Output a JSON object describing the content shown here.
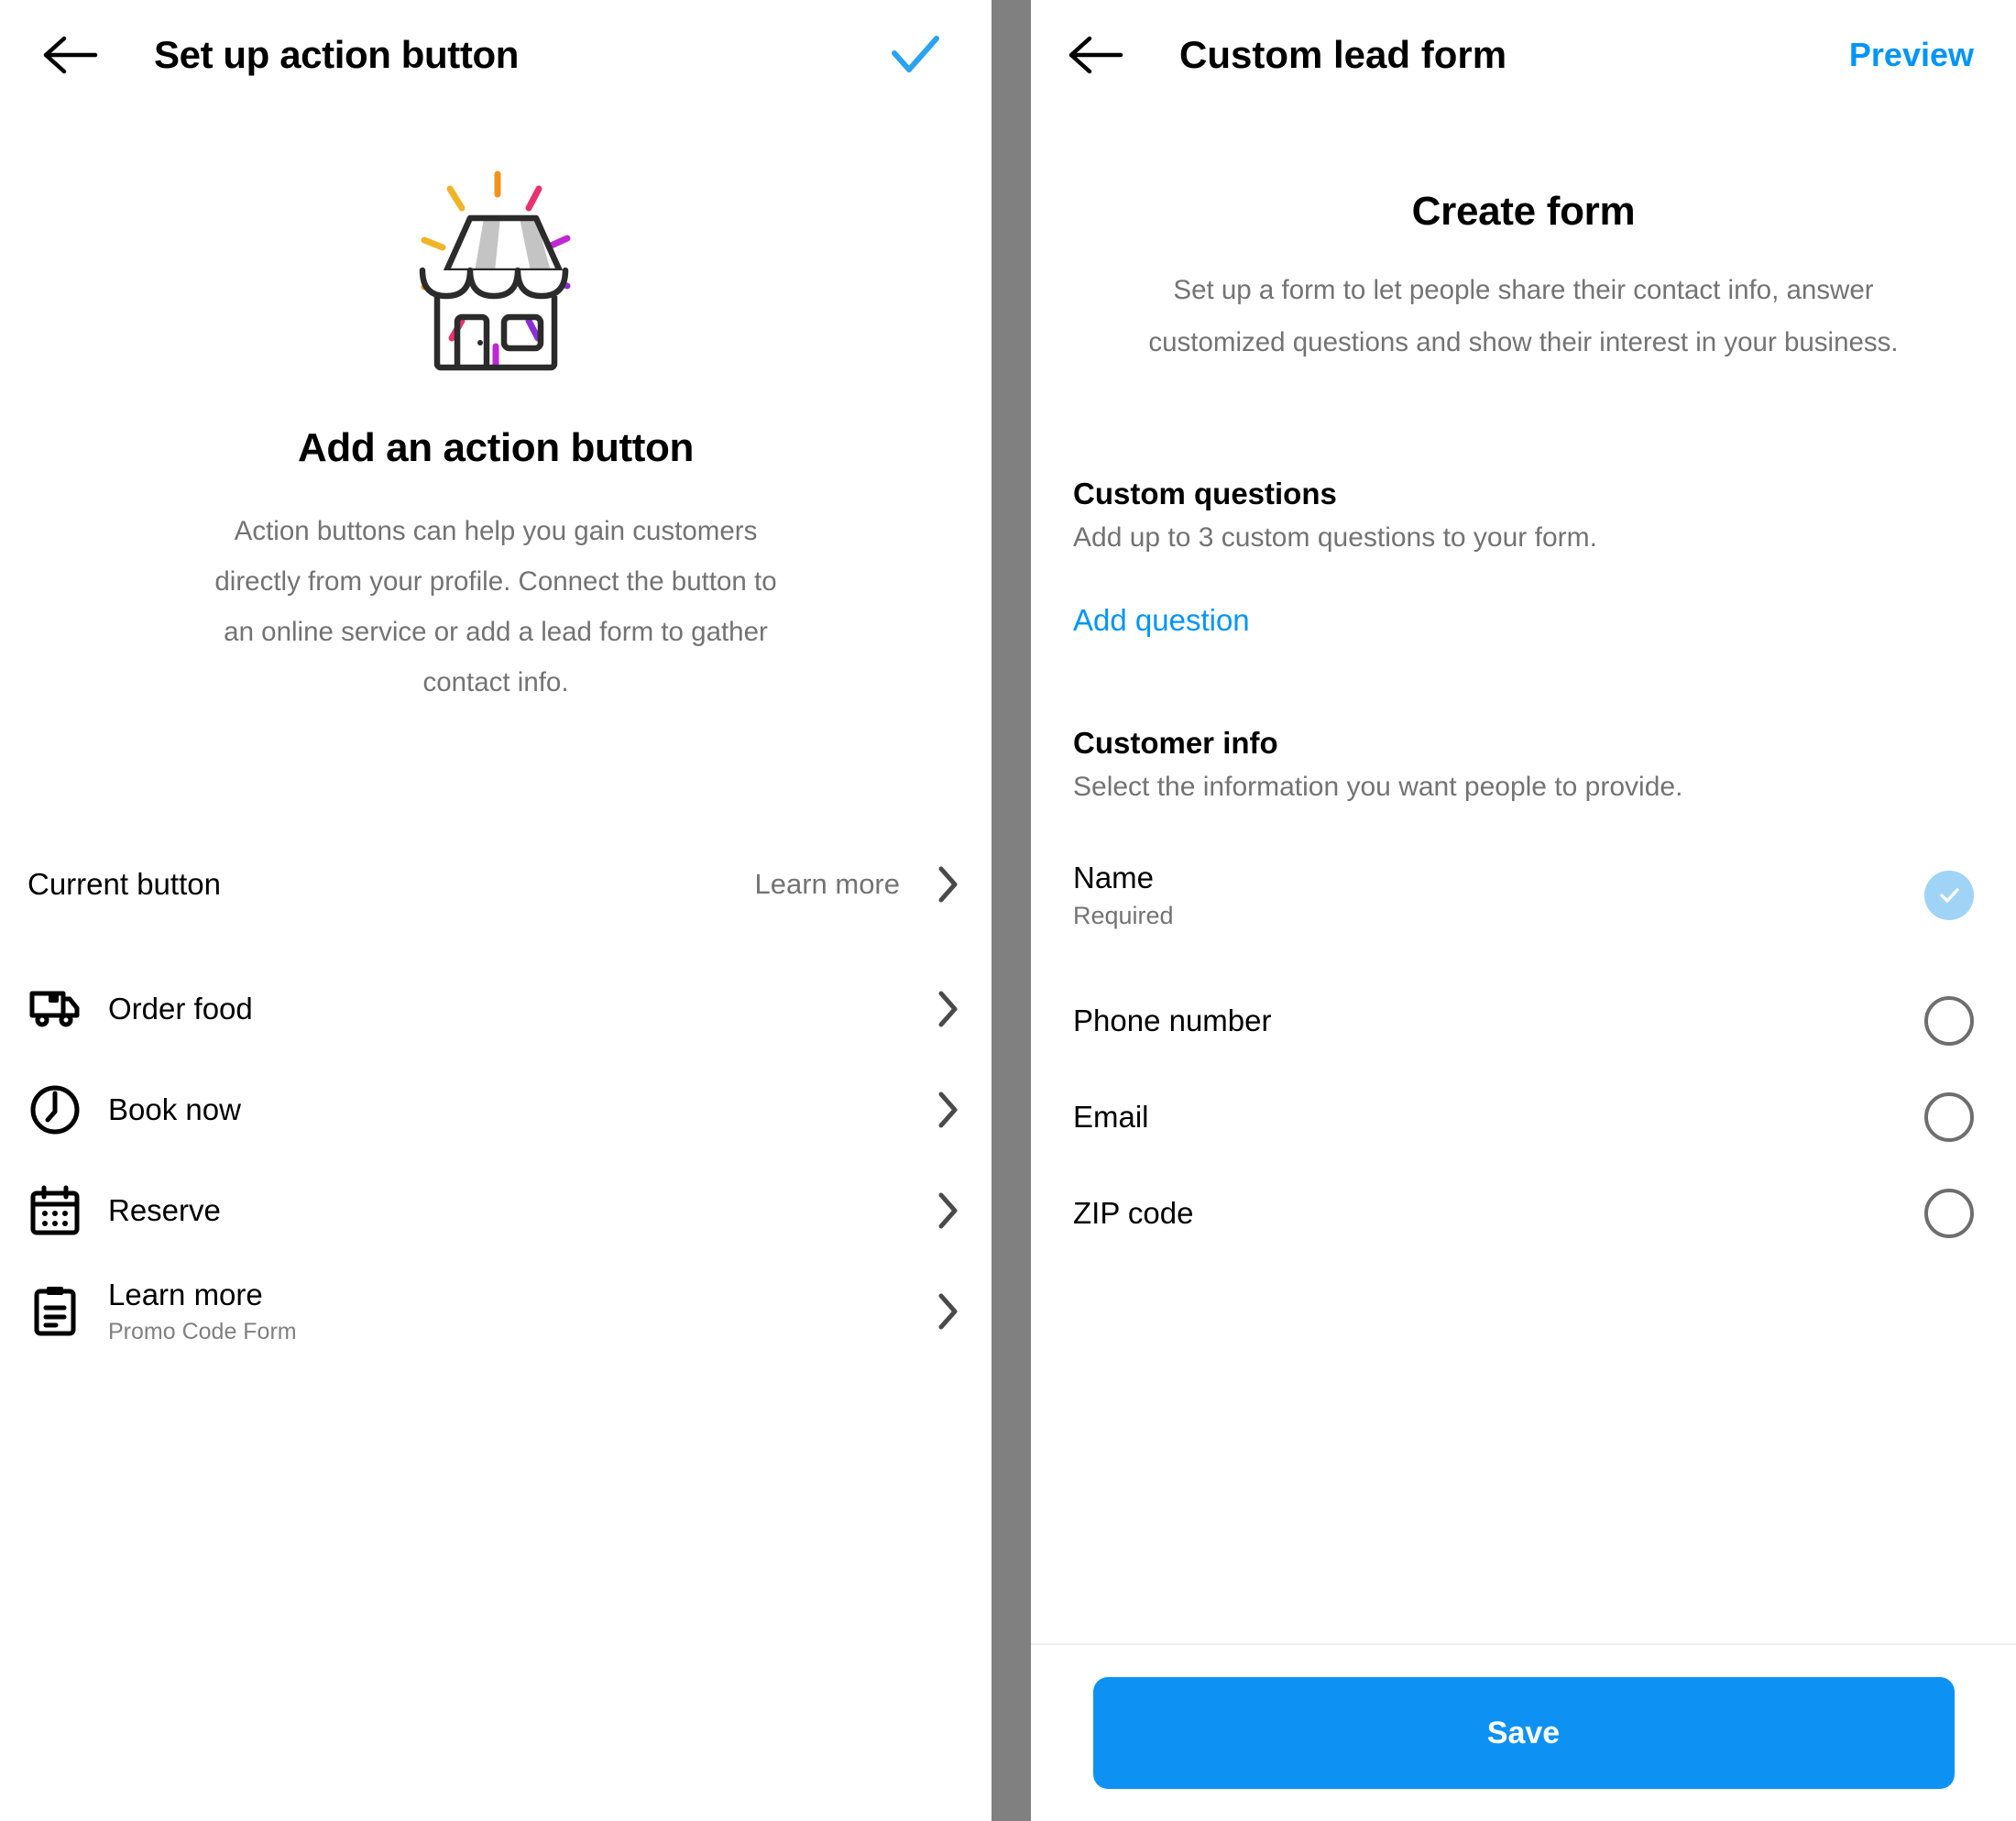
{
  "left_panel": {
    "header": {
      "back_icon": "back-arrow-icon",
      "title": "Set up action button",
      "confirm_icon": "checkmark-icon"
    },
    "illustration": {
      "name": "storefront-illustration",
      "sparkle_colors": [
        "#f2921d",
        "#f0b429",
        "#e8336e",
        "#c026d3",
        "#8b2fd6"
      ],
      "awning_stripe_color": "#c4c4c4",
      "outline_color": "#2b2b2b"
    },
    "title": "Add an action button",
    "description": "Action buttons can help you gain customers directly from your profile. Connect the button to an online service or add a lead form to gather contact info.",
    "current_button": {
      "label": "Current button",
      "value": "Learn more",
      "chevron_icon": "chevron-right-icon"
    },
    "actions": [
      {
        "icon": "delivery-truck-icon",
        "label": "Order food",
        "sublabel": ""
      },
      {
        "icon": "clock-icon",
        "label": "Book now",
        "sublabel": ""
      },
      {
        "icon": "calendar-icon",
        "label": "Reserve",
        "sublabel": ""
      },
      {
        "icon": "clipboard-icon",
        "label": "Learn more",
        "sublabel": "Promo Code Form"
      }
    ]
  },
  "right_panel": {
    "header": {
      "back_icon": "back-arrow-icon",
      "title": "Custom lead form",
      "preview_label": "Preview"
    },
    "title": "Create form",
    "description": "Set up a form to let people share their contact info, answer customized questions and show their interest in your business.",
    "custom_questions": {
      "title": "Custom questions",
      "description": "Add up to 3 custom questions to your form.",
      "add_link": "Add question"
    },
    "customer_info": {
      "title": "Customer info",
      "description": "Select the information you want people to provide.",
      "fields": [
        {
          "label": "Name",
          "note": "Required",
          "checked": true
        },
        {
          "label": "Phone number",
          "note": "",
          "checked": false
        },
        {
          "label": "Email",
          "note": "",
          "checked": false
        },
        {
          "label": "ZIP code",
          "note": "",
          "checked": false
        }
      ]
    },
    "save_label": "Save"
  },
  "colors": {
    "accent_blue": "#0095f6",
    "save_button_blue": "#0d92f4",
    "checkbox_on": "#9fd4f7",
    "divider_gray": "#808080",
    "muted_text": "#737373"
  }
}
